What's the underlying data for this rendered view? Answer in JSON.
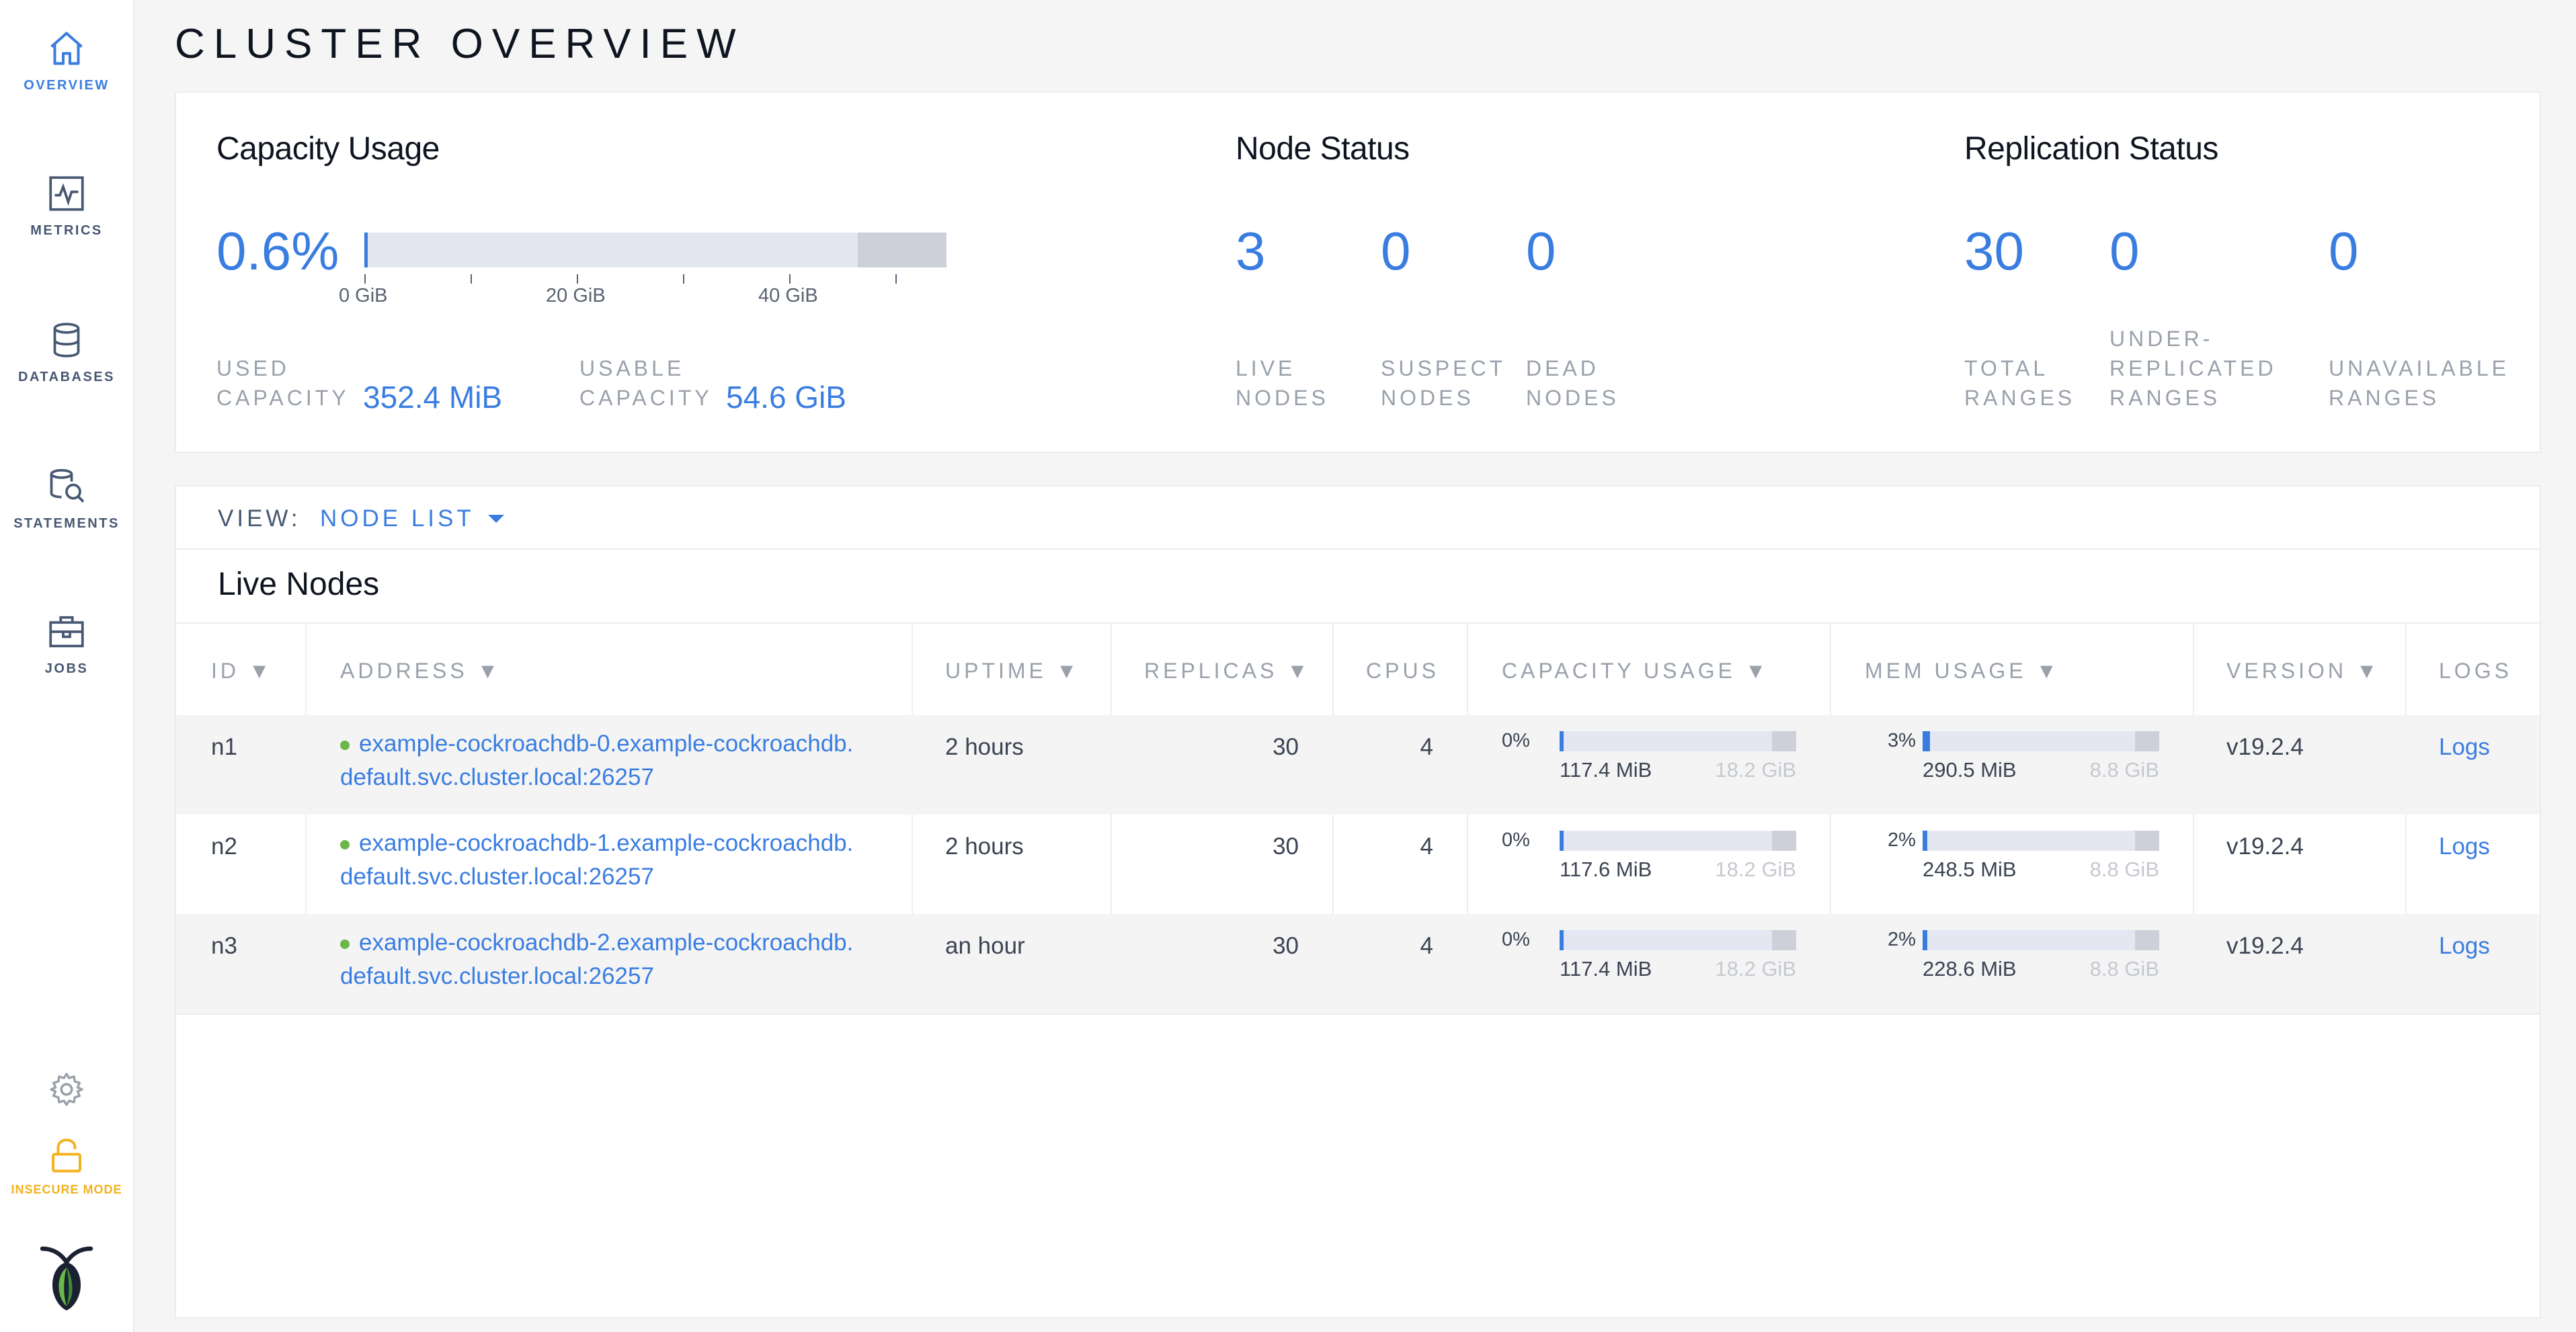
{
  "sidebar": {
    "items": [
      {
        "label": "OVERVIEW",
        "icon": "home-icon"
      },
      {
        "label": "METRICS",
        "icon": "metrics-icon"
      },
      {
        "label": "DATABASES",
        "icon": "database-icon"
      },
      {
        "label": "STATEMENTS",
        "icon": "statements-icon"
      },
      {
        "label": "JOBS",
        "icon": "jobs-icon"
      }
    ],
    "settings_icon": "gear-icon",
    "insecure_label": "INSECURE MODE",
    "logo": "cockroach-logo"
  },
  "page": {
    "title": "CLUSTER OVERVIEW"
  },
  "capacity": {
    "title": "Capacity Usage",
    "percent": "0.6%",
    "percent_value": 0.6,
    "ticks": [
      "0 GiB",
      "20 GiB",
      "40 GiB"
    ],
    "used_label": "USED CAPACITY",
    "used_label_l1": "USED",
    "used_label_l2": "CAPACITY",
    "used_value": "352.4 MiB",
    "usable_label_l1": "USABLE",
    "usable_label_l2": "CAPACITY",
    "usable_value": "54.6 GiB"
  },
  "node_status": {
    "title": "Node Status",
    "live": "3",
    "suspect": "0",
    "dead": "0",
    "live_l1": "LIVE",
    "live_l2": "NODES",
    "suspect_l1": "SUSPECT",
    "suspect_l2": "NODES",
    "dead_l1": "DEAD",
    "dead_l2": "NODES"
  },
  "replication": {
    "title": "Replication Status",
    "total": "30",
    "under": "0",
    "unavailable": "0",
    "total_l1": "TOTAL",
    "total_l2": "RANGES",
    "under_l1": "UNDER-",
    "under_l2": "REPLICATED",
    "under_l3": "RANGES",
    "unavail_l1": "UNAVAILABLE",
    "unavail_l2": "RANGES"
  },
  "view": {
    "label": "VIEW:",
    "selected": "NODE LIST"
  },
  "live_nodes": {
    "title": "Live Nodes",
    "columns": [
      "ID ▼",
      "ADDRESS ▼",
      "UPTIME ▼",
      "REPLICAS ▼",
      "CPUS",
      "CAPACITY USAGE ▼",
      "MEM USAGE ▼",
      "VERSION ▼",
      "LOGS"
    ],
    "rows": [
      {
        "id": "n1",
        "addr_l1": "example-cockroachdb-0.example-cockroachdb.",
        "addr_l2": "default.svc.cluster.local:26257",
        "uptime": "2 hours",
        "replicas": "30",
        "cpus": "4",
        "cap_pct": "0%",
        "cap_fraction": 0.006,
        "cap_used": "117.4 MiB",
        "cap_total": "18.2 GiB",
        "mem_pct": "3%",
        "mem_fraction": 0.03,
        "mem_used": "290.5 MiB",
        "mem_total": "8.8 GiB",
        "version": "v19.2.4",
        "logs": "Logs"
      },
      {
        "id": "n2",
        "addr_l1": "example-cockroachdb-1.example-cockroachdb.",
        "addr_l2": "default.svc.cluster.local:26257",
        "uptime": "2 hours",
        "replicas": "30",
        "cpus": "4",
        "cap_pct": "0%",
        "cap_fraction": 0.006,
        "cap_used": "117.6 MiB",
        "cap_total": "18.2 GiB",
        "mem_pct": "2%",
        "mem_fraction": 0.02,
        "mem_used": "248.5 MiB",
        "mem_total": "8.8 GiB",
        "version": "v19.2.4",
        "logs": "Logs"
      },
      {
        "id": "n3",
        "addr_l1": "example-cockroachdb-2.example-cockroachdb.",
        "addr_l2": "default.svc.cluster.local:26257",
        "uptime": "an hour",
        "replicas": "30",
        "cpus": "4",
        "cap_pct": "0%",
        "cap_fraction": 0.006,
        "cap_used": "117.4 MiB",
        "cap_total": "18.2 GiB",
        "mem_pct": "2%",
        "mem_fraction": 0.02,
        "mem_used": "228.6 MiB",
        "mem_total": "8.8 GiB",
        "version": "v19.2.4",
        "logs": "Logs"
      }
    ]
  },
  "colors": {
    "accent": "#3a7de1",
    "warning": "#f2b31f",
    "live": "#6bb84a"
  }
}
